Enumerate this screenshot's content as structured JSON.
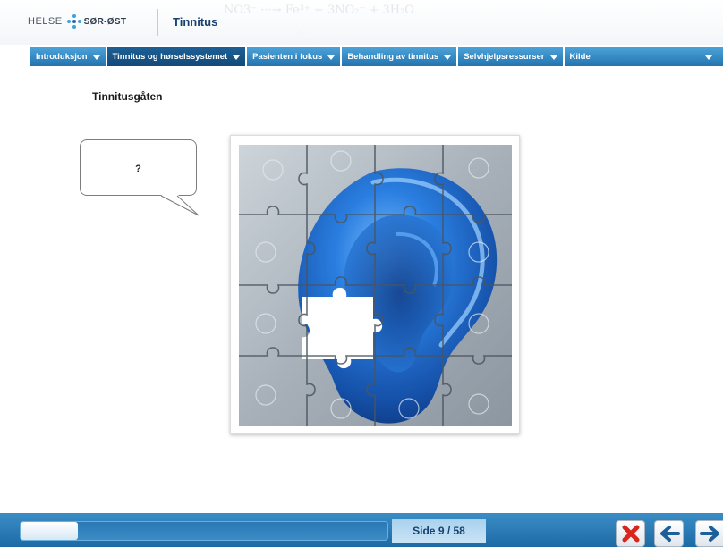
{
  "header": {
    "logo_text_left": "HELSE",
    "logo_text_right": "SØR-ØST",
    "app_title": "Tinnitus",
    "watermark": "NO3⁻ ···→ Fe³⁺ + 3NO₂⁻ + 3H₂O"
  },
  "nav": {
    "tabs": [
      {
        "label": "Introduksjon",
        "active": false
      },
      {
        "label": "Tinnitus og hørselssystemet",
        "active": true
      },
      {
        "label": "Pasienten i fokus",
        "active": false
      },
      {
        "label": "Behandling av tinnitus",
        "active": false
      },
      {
        "label": "Selvhjelpsressurser",
        "active": false
      },
      {
        "label": "Kilde",
        "active": false
      }
    ]
  },
  "content": {
    "heading": "Tinnitusgåten",
    "bubble_text": "?",
    "image_subject": "blue-ear-puzzle-missing-piece"
  },
  "footer": {
    "progress_fraction": 0.155,
    "page_label": "Side 9 / 58",
    "buttons": {
      "close_icon": "close-x-icon",
      "back_icon": "arrow-left-icon",
      "next_icon": "arrow-right-icon"
    }
  },
  "colors": {
    "nav_blue": "#2474af",
    "nav_active": "#134a78",
    "footer_blue": "#1d6aa5",
    "close_red": "#d8261c",
    "ear_blue": "#1f6fd0",
    "puzzle_grey": "#a9b3bd"
  }
}
